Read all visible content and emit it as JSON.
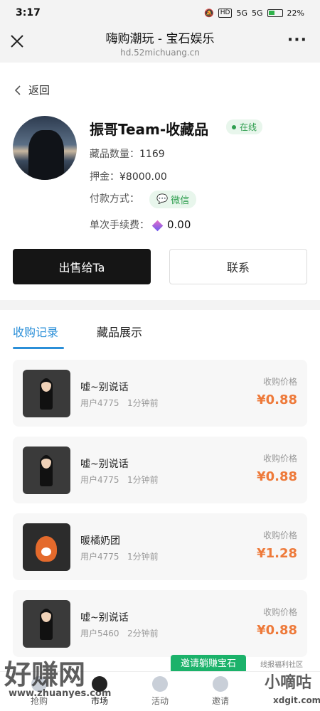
{
  "status": {
    "time": "3:17",
    "hd": "HD",
    "signal1": "5G",
    "signal2": "5G",
    "battery": "22"
  },
  "titlebar": {
    "title": "嗨购潮玩 - 宝石娱乐",
    "url": "hd.52michuang.cn"
  },
  "profile": {
    "back_label": "返回",
    "name": "振哥Team-收藏品",
    "online_label": "在线",
    "count_label": "藏品数量：",
    "count_value": "1169",
    "deposit_label": "押金：",
    "deposit_value": "¥8000.00",
    "payment_label": "付款方式：",
    "payment_value": "微信",
    "fee_label": "单次手续费：",
    "fee_value": "0.00",
    "sell_button": "出售给Ta",
    "contact_button": "联系"
  },
  "tabs": [
    {
      "label": "收购记录"
    },
    {
      "label": "藏品展示"
    }
  ],
  "records": [
    {
      "name": "嘘~别说话",
      "user": "用户4775",
      "time": "1分钟前",
      "price_label": "收购价格",
      "price": "¥0.88"
    },
    {
      "name": "嘘~别说话",
      "user": "用户4775",
      "time": "1分钟前",
      "price_label": "收购价格",
      "price": "¥0.88"
    },
    {
      "name": "暖橘奶团",
      "user": "用户4775",
      "time": "1分钟前",
      "price_label": "收购价格",
      "price": "¥1.28"
    },
    {
      "name": "嘘~别说话",
      "user": "用户5460",
      "time": "2分钟前",
      "price_label": "收购价格",
      "price": "¥0.88"
    }
  ],
  "invite_banner": "邀请躺赚宝石",
  "nav": [
    {
      "label": "抢购"
    },
    {
      "label": "市场"
    },
    {
      "label": "活动"
    },
    {
      "label": "邀请"
    }
  ],
  "watermarks": {
    "left": "好赚网",
    "left_url": "www.zhuanyes.com",
    "right": "小嘀咕",
    "right_url": "xdgit.com",
    "right_small": "线报福利社区"
  }
}
